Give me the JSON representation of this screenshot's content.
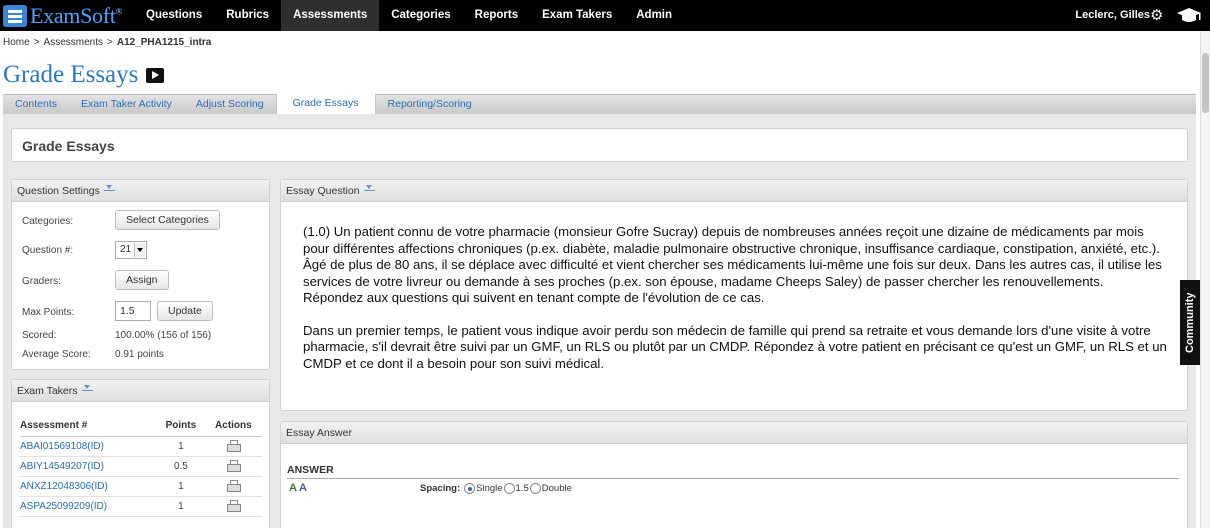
{
  "app": {
    "logo_text": "ExamSoft",
    "logo_tm": "®"
  },
  "nav": {
    "items": [
      "Questions",
      "Rubrics",
      "Assessments",
      "Categories",
      "Reports",
      "Exam Takers",
      "Admin"
    ],
    "active": "Assessments",
    "user": "Leclerc, Gilles"
  },
  "breadcrumb": {
    "home": "Home",
    "sep": ">",
    "section": "Assessments",
    "current": "A12_PHA1215_intra"
  },
  "page": {
    "title": "Grade Essays"
  },
  "tabs": [
    "Contents",
    "Exam Taker Activity",
    "Adjust Scoring",
    "Grade Essays",
    "Reporting/Scoring"
  ],
  "active_tab": "Grade Essays",
  "grade_panel": {
    "title": "Grade Essays"
  },
  "question_settings": {
    "title": "Question Settings",
    "categories_label": "Categories:",
    "select_categories_btn": "Select Categories",
    "question_label": "Question #:",
    "question_value": "21",
    "graders_label": "Graders:",
    "assign_btn": "Assign",
    "max_points_label": "Max Points:",
    "max_points_value": "1.5",
    "update_btn": "Update",
    "scored_label": "Scored:",
    "scored_value": "100.00% (156 of 156)",
    "average_label": "Average Score:",
    "average_value": "0.91 points"
  },
  "exam_takers": {
    "title": "Exam Takers",
    "columns": [
      "Assessment #",
      "Points",
      "Actions"
    ],
    "rows": [
      {
        "id": "ABAI01569108(ID)",
        "points": "1"
      },
      {
        "id": "ABIY14549207(ID)",
        "points": "0.5"
      },
      {
        "id": "ANXZ12048306(ID)",
        "points": "1"
      },
      {
        "id": "ASPA25099209(ID)",
        "points": "1"
      }
    ]
  },
  "essay_question": {
    "title": "Essay Question",
    "paragraph1": "(1.0) Un patient connu de votre pharmacie (monsieur Gofre Sucray) depuis de nombreuses années reçoit une dizaine de médicaments par mois pour différentes affections chroniques (p.ex. diabète, maladie pulmonaire obstructive chronique, insuffisance cardiaque, constipation, anxiété, etc.). Âgé de plus de 80 ans, il se déplace avec difficulté et vient chercher ses médicaments lui-même une fois sur deux.  Dans les autres cas, il utilise les services de votre livreur ou demande à ses proches (p.ex. son épouse, madame Cheeps Saley) de passer chercher les renouvellements. Répondez aux questions qui suivent en tenant compte de l'évolution de ce cas.",
    "paragraph2": "Dans un premier temps, le patient vous indique avoir perdu son médecin de famille qui prend sa retraite et vous demande lors d'une visite à votre pharmacie, s'il devrait être suivi par un GMF, un RLS ou plutôt par un CMDP. Répondez à votre patient en précisant  ce qu'est un GMF, un RLS et un CMDP et ce dont il a besoin pour son suivi médical."
  },
  "essay_answer": {
    "title": "Essay Answer",
    "answer_label": "ANSWER",
    "spacing_label": "Spacing:",
    "spacing_options": [
      "Single",
      "1.5",
      "Double"
    ],
    "spacing_selected": "Single"
  },
  "community": {
    "label": "Community"
  }
}
